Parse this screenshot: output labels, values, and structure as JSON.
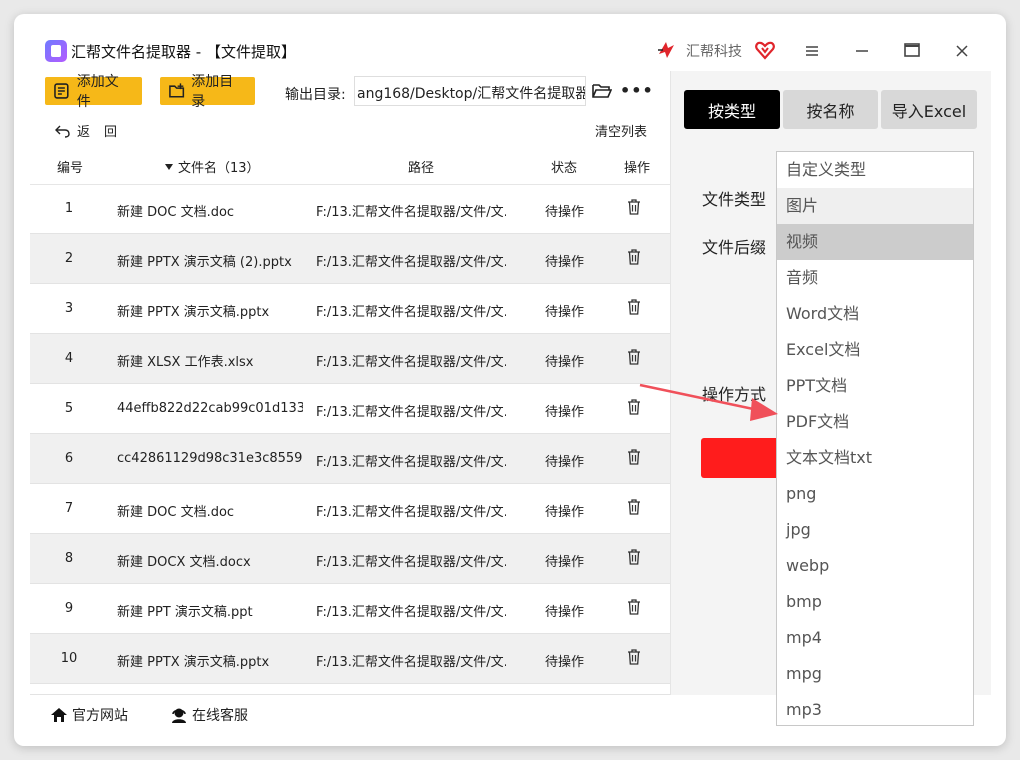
{
  "window": {
    "title": "汇帮文件名提取器 - 【文件提取】",
    "brand": "汇帮科技"
  },
  "toolbar": {
    "add_file": "添加文件",
    "add_dir": "添加目录",
    "output_label": "输出目录:",
    "output_path": "ang168/Desktop/汇帮文件名提取器",
    "more": "•••",
    "back": "返",
    "back2": "回",
    "clear": "清空列表"
  },
  "table": {
    "headers": {
      "num": "编号",
      "name": "文件名（13）",
      "path": "路径",
      "status": "状态",
      "op": "操作"
    },
    "rows": [
      {
        "num": "1",
        "name": "新建 DOC 文档.doc",
        "path": "F:/13.汇帮文件名提取器/文件/文...",
        "status": "待操作"
      },
      {
        "num": "2",
        "name": "新建 PPTX 演示文稿 (2).pptx",
        "path": "F:/13.汇帮文件名提取器/文件/文...",
        "status": "待操作"
      },
      {
        "num": "3",
        "name": "新建 PPTX 演示文稿.pptx",
        "path": "F:/13.汇帮文件名提取器/文件/文...",
        "status": "待操作"
      },
      {
        "num": "4",
        "name": "新建 XLSX 工作表.xlsx",
        "path": "F:/13.汇帮文件名提取器/文件/文...",
        "status": "待操作"
      },
      {
        "num": "5",
        "name": "44effb822d22cab99c01d1331...",
        "path": "F:/13.汇帮文件名提取器/文件/文...",
        "status": "待操作"
      },
      {
        "num": "6",
        "name": "cc42861129d98c31e3c8559e5...",
        "path": "F:/13.汇帮文件名提取器/文件/文...",
        "status": "待操作"
      },
      {
        "num": "7",
        "name": "新建 DOC 文档.doc",
        "path": "F:/13.汇帮文件名提取器/文件/文...",
        "status": "待操作"
      },
      {
        "num": "8",
        "name": "新建 DOCX 文档.docx",
        "path": "F:/13.汇帮文件名提取器/文件/文...",
        "status": "待操作"
      },
      {
        "num": "9",
        "name": "新建 PPT 演示文稿.ppt",
        "path": "F:/13.汇帮文件名提取器/文件/文...",
        "status": "待操作"
      },
      {
        "num": "10",
        "name": "新建 PPTX 演示文稿.pptx",
        "path": "F:/13.汇帮文件名提取器/文件/文...",
        "status": "待操作"
      }
    ]
  },
  "bottom": {
    "website": "官方网站",
    "service": "在线客服"
  },
  "right": {
    "tabs": [
      "按类型",
      "按名称",
      "导入Excel"
    ],
    "file_type_label": "文件类型",
    "file_suffix_label": "文件后缀",
    "operation_label": "操作方式"
  },
  "dropdown": {
    "items": [
      "自定义类型",
      "图片",
      "视频",
      "音频",
      "Word文档",
      "Excel文档",
      "PPT文档",
      "PDF文档",
      "文本文档txt",
      "png",
      "jpg",
      "webp",
      "bmp",
      "mp4",
      "mpg",
      "mp3"
    ],
    "selected": "视频"
  },
  "colors": {
    "accent_yellow": "#f6b818",
    "start_red": "#ff1c1c",
    "arrow": "#f0505a"
  }
}
